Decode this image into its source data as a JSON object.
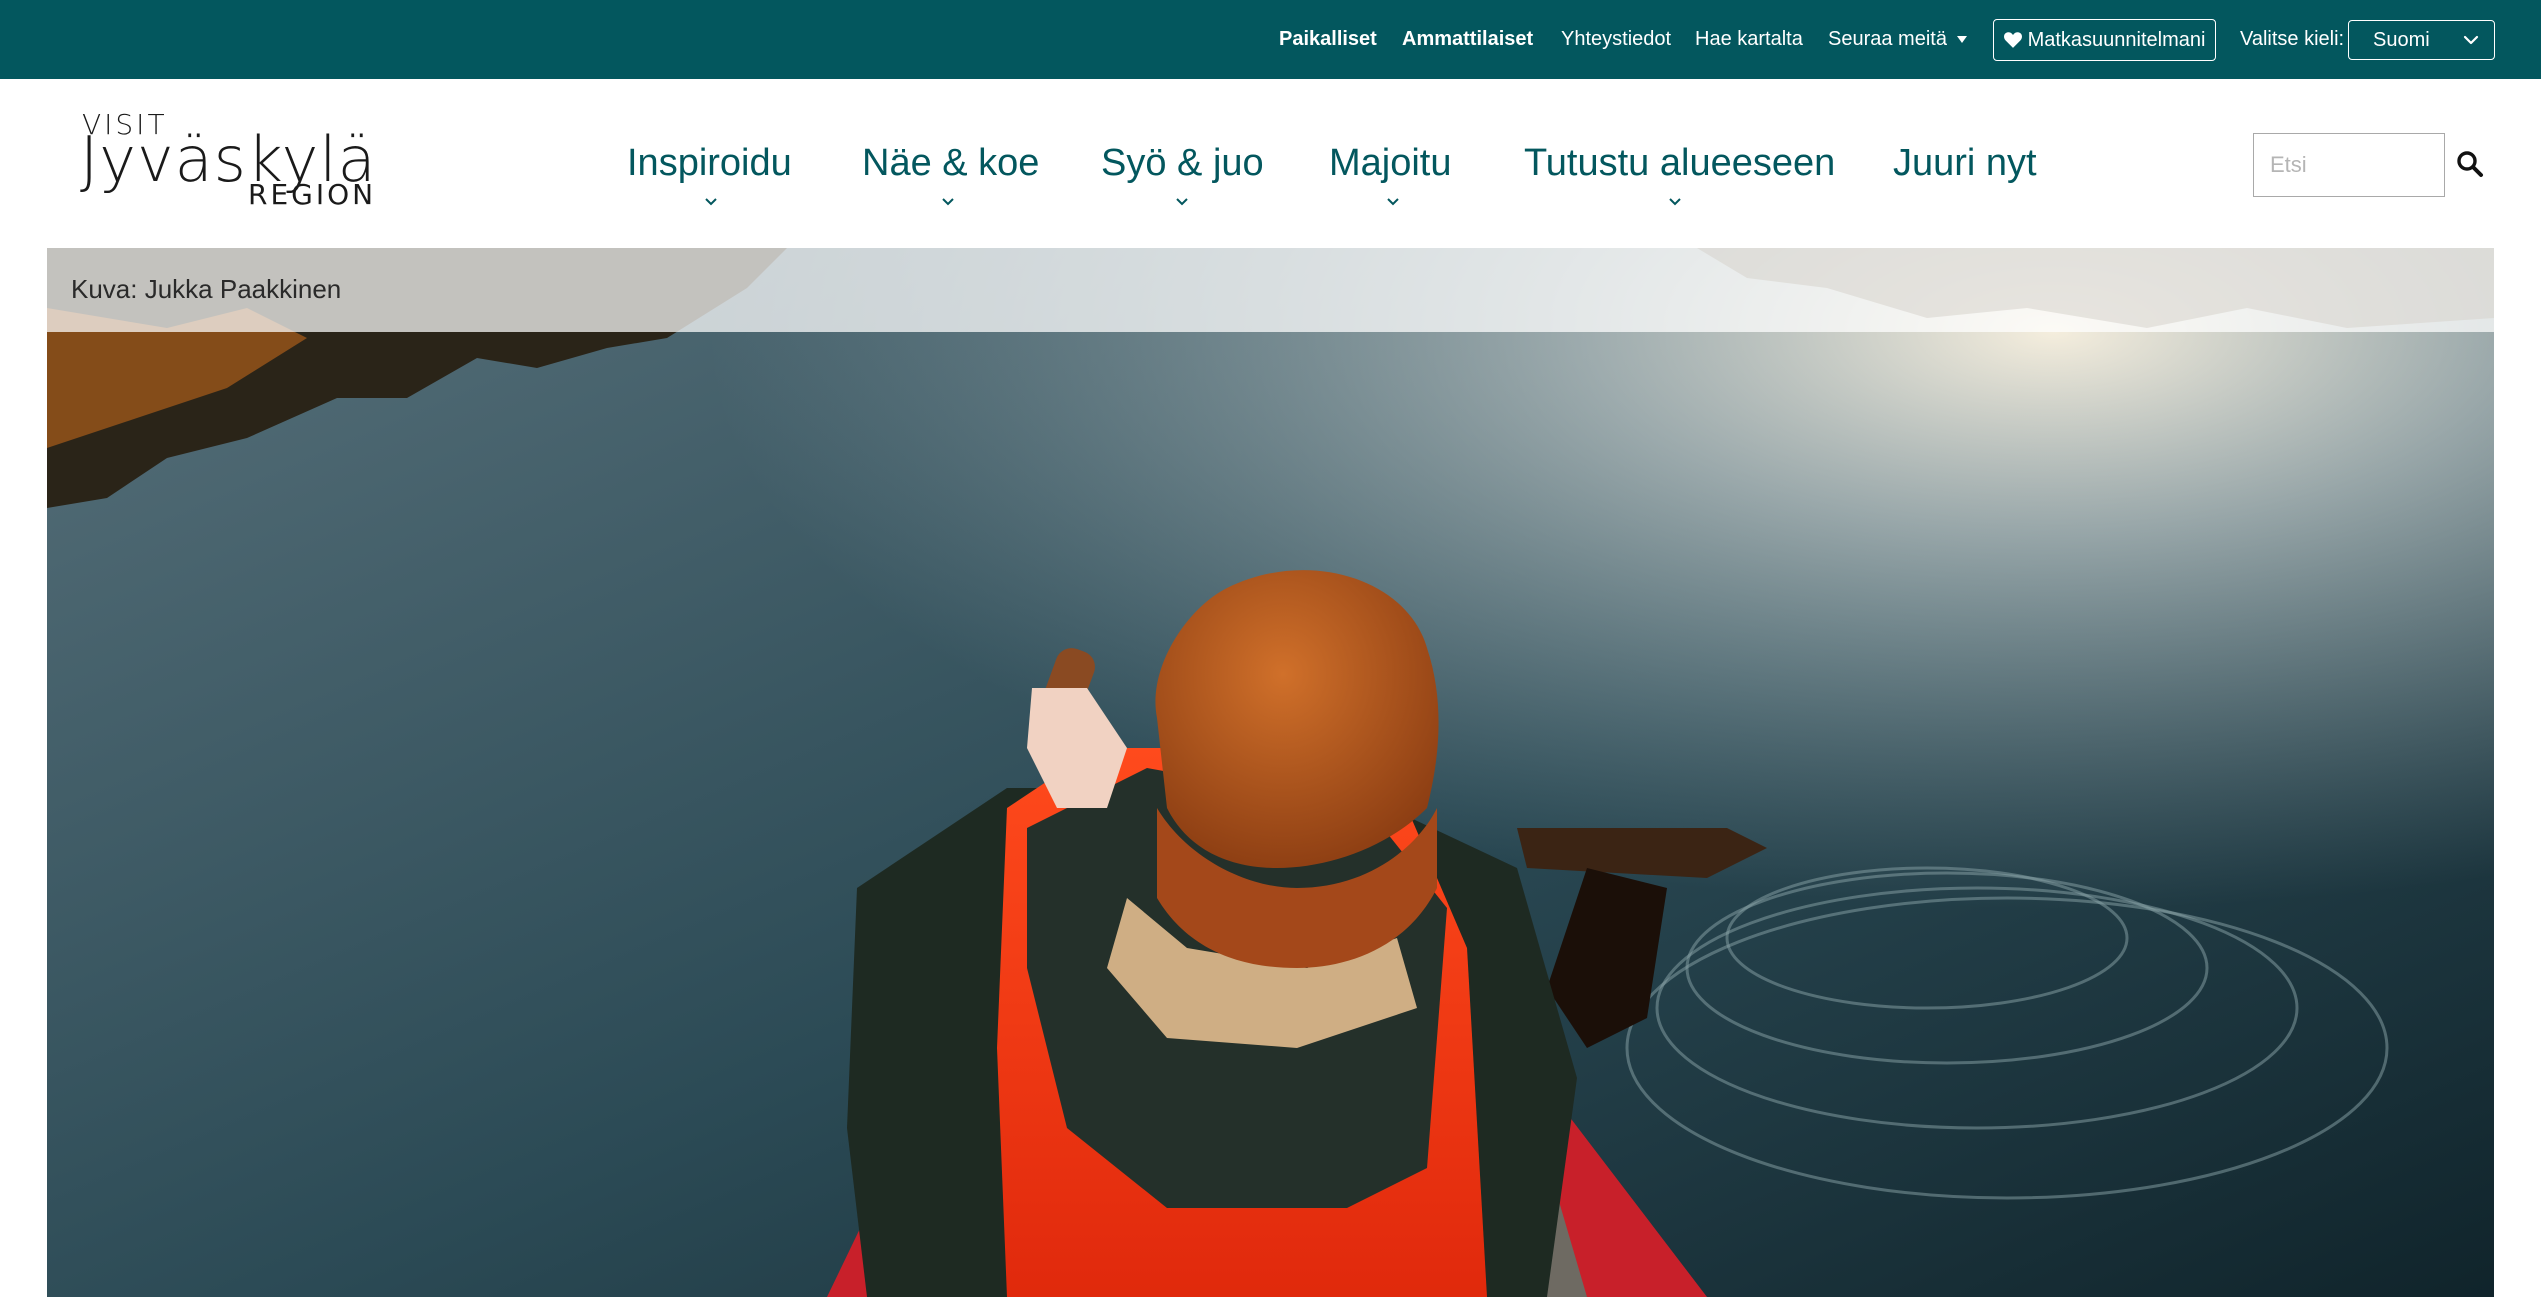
{
  "topbar": {
    "links": [
      {
        "label": "Paikalliset",
        "bold": true
      },
      {
        "label": "Ammattilaiset",
        "bold": true
      },
      {
        "label": "Yhteystiedot",
        "bold": false
      },
      {
        "label": "Hae kartalta",
        "bold": false
      },
      {
        "label": "Seuraa meitä",
        "bold": false
      }
    ],
    "trip_planner_label": "Matkasuunnitelmani",
    "language_label": "Valitse kieli:",
    "language_value": "Suomi"
  },
  "logo": {
    "line1": "VISIT",
    "line2": "Jyväskylä",
    "line3": "REGION"
  },
  "nav": {
    "items": [
      {
        "label": "Inspiroidu",
        "has_dropdown": true
      },
      {
        "label": "Näe & koe",
        "has_dropdown": true
      },
      {
        "label": "Syö & juo",
        "has_dropdown": true
      },
      {
        "label": "Majoitu",
        "has_dropdown": true
      },
      {
        "label": "Tutustu alueeseen",
        "has_dropdown": true
      },
      {
        "label": "Juuri nyt",
        "has_dropdown": false
      }
    ]
  },
  "search": {
    "placeholder": "Etsi",
    "icon": "search-icon"
  },
  "hero": {
    "caption": "Kuva: Jukka Paakkinen"
  },
  "colors": {
    "brand_teal": "#03575e",
    "white": "#ffffff"
  }
}
